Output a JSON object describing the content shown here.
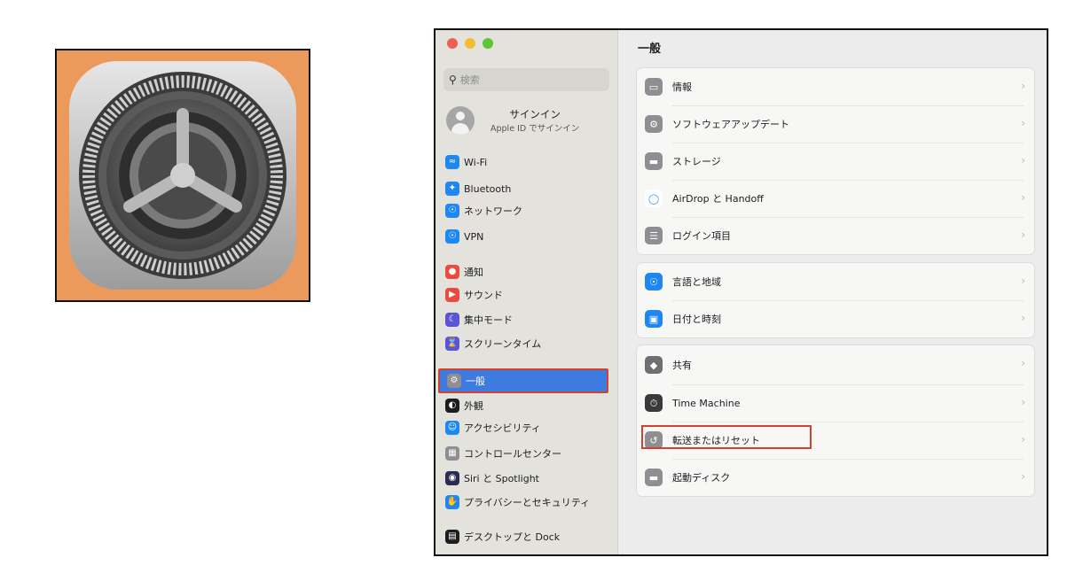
{
  "sidebar": {
    "search_placeholder": "検索",
    "account": {
      "name": "サインイン",
      "sub": "Apple ID でサインイン"
    },
    "items": [
      {
        "label": "Wi-Fi",
        "icon": "wifi-icon",
        "color": "#1e88f0"
      },
      {
        "label": "Bluetooth",
        "icon": "bluetooth-icon",
        "color": "#1e88f0"
      },
      {
        "label": "ネットワーク",
        "icon": "globe-icon",
        "color": "#1e88f0"
      },
      {
        "label": "VPN",
        "icon": "vpn-globe-icon",
        "color": "#1e88f0"
      },
      {
        "label": "通知",
        "icon": "bell-icon",
        "color": "#eb4a3f"
      },
      {
        "label": "サウンド",
        "icon": "speaker-icon",
        "color": "#eb4a3f"
      },
      {
        "label": "集中モード",
        "icon": "moon-icon",
        "color": "#5b55d6"
      },
      {
        "label": "スクリーンタイム",
        "icon": "hourglass-icon",
        "color": "#5b55d6"
      },
      {
        "label": "一般",
        "icon": "gear-icon",
        "color": "#8e8e93"
      },
      {
        "label": "外観",
        "icon": "appearance-icon",
        "color": "#1d1d1f"
      },
      {
        "label": "アクセシビリティ",
        "icon": "accessibility-icon",
        "color": "#1e88f0"
      },
      {
        "label": "コントロールセンター",
        "icon": "control-center-icon",
        "color": "#8e8e93"
      },
      {
        "label": "Siri と Spotlight",
        "icon": "siri-icon",
        "color": "#2b2b52"
      },
      {
        "label": "プライバシーとセキュリティ",
        "icon": "hand-icon",
        "color": "#1e88f0"
      },
      {
        "label": "デスクトップと Dock",
        "icon": "dock-icon",
        "color": "#1d1d1f"
      }
    ]
  },
  "content": {
    "title": "一般",
    "groups": [
      [
        {
          "label": "情報",
          "icon": "laptop-icon",
          "color": "#8e8e93"
        },
        {
          "label": "ソフトウェアアップデート",
          "icon": "gear-badge-icon",
          "color": "#8e8e93"
        },
        {
          "label": "ストレージ",
          "icon": "drive-icon",
          "color": "#8e8e93"
        },
        {
          "label": "AirDrop と Handoff",
          "icon": "airdrop-icon",
          "color": "#ffffff"
        },
        {
          "label": "ログイン項目",
          "icon": "list-icon",
          "color": "#8e8e93"
        }
      ],
      [
        {
          "label": "言語と地域",
          "icon": "globe-icon",
          "color": "#1e88f0"
        },
        {
          "label": "日付と時刻",
          "icon": "calendar-clock-icon",
          "color": "#1e88f0"
        }
      ],
      [
        {
          "label": "共有",
          "icon": "sharing-icon",
          "color": "#6e6e73"
        },
        {
          "label": "Time Machine",
          "icon": "time-machine-icon",
          "color": "#3a3a3c"
        },
        {
          "label": "転送またはリセット",
          "icon": "reset-icon",
          "color": "#8e8e93"
        },
        {
          "label": "起動ディスク",
          "icon": "drive-icon",
          "color": "#8e8e93"
        }
      ]
    ]
  }
}
